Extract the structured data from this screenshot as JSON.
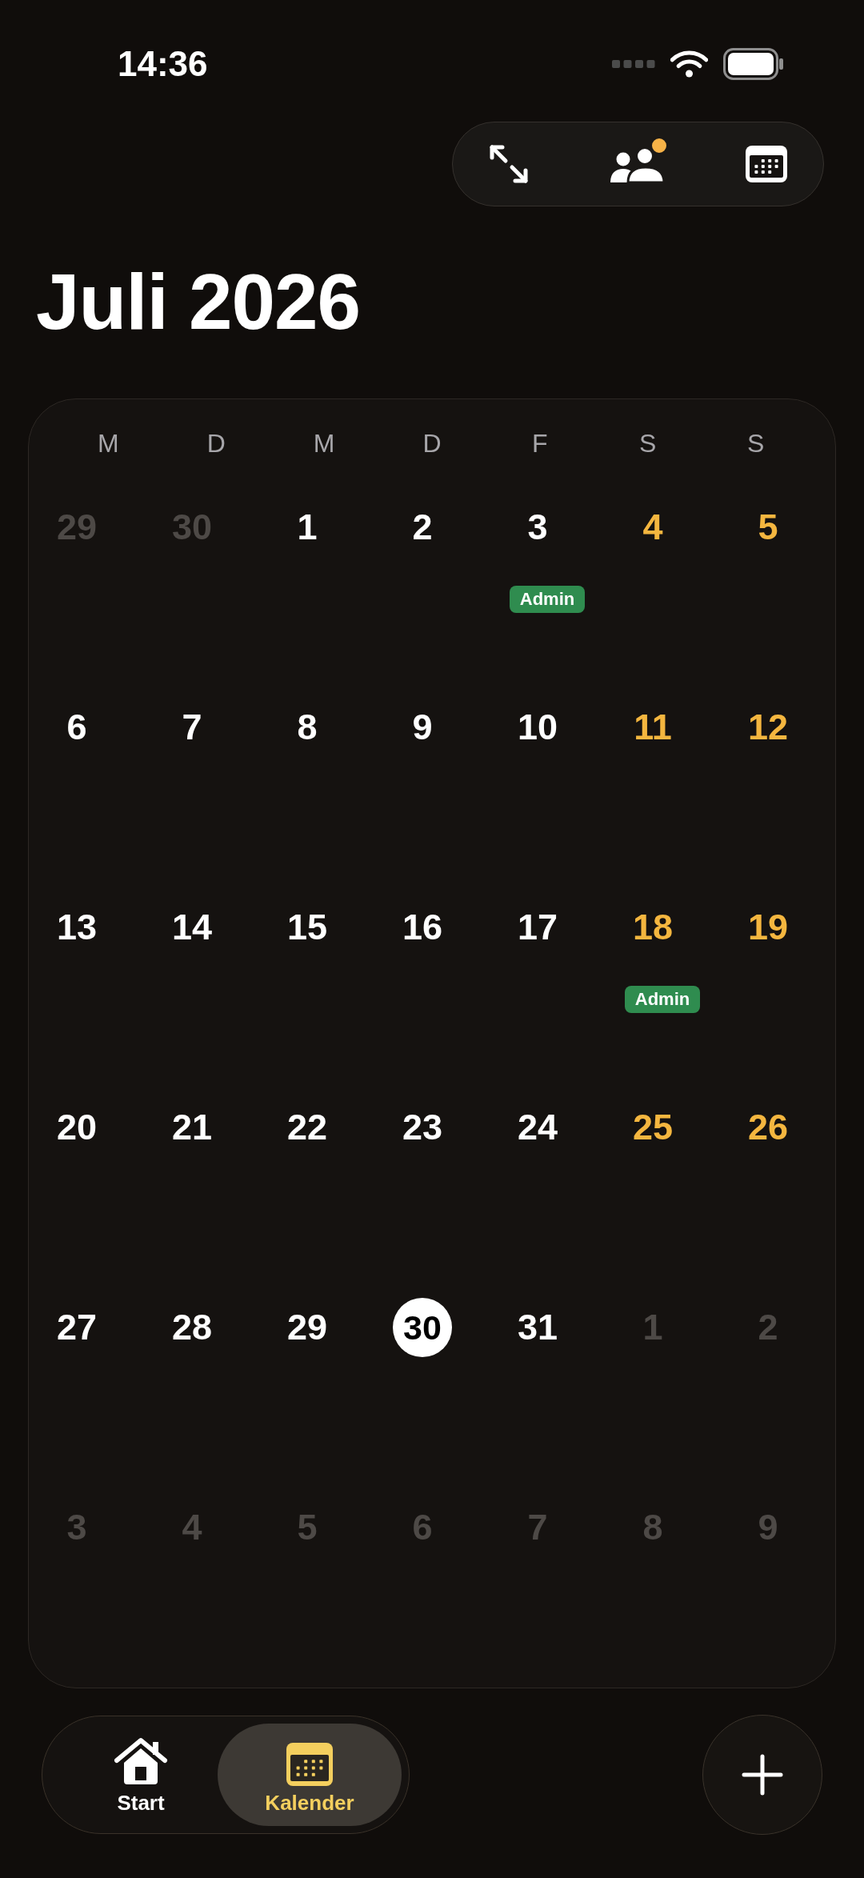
{
  "status_bar": {
    "time": "14:36"
  },
  "toolbar": {
    "buttons": [
      {
        "notify": false
      },
      {
        "notify": true
      },
      {
        "notify": false
      }
    ]
  },
  "title": "Juli 2026",
  "calendar": {
    "weekdays": [
      "M",
      "D",
      "M",
      "D",
      "F",
      "S",
      "S"
    ],
    "weeks": [
      {
        "days": [
          {
            "day": "29",
            "kind": "other_month"
          },
          {
            "day": "30",
            "kind": "other_month"
          },
          {
            "day": "1",
            "kind": "weekday"
          },
          {
            "day": "2",
            "kind": "weekday"
          },
          {
            "day": "3",
            "kind": "weekday",
            "events": [
              {
                "label": "Admin",
                "color": "#2f8c4f"
              }
            ]
          },
          {
            "day": "4",
            "kind": "weekend"
          },
          {
            "day": "5",
            "kind": "weekend"
          }
        ]
      },
      {
        "days": [
          {
            "day": "6",
            "kind": "weekday"
          },
          {
            "day": "7",
            "kind": "weekday"
          },
          {
            "day": "8",
            "kind": "weekday"
          },
          {
            "day": "9",
            "kind": "weekday"
          },
          {
            "day": "10",
            "kind": "weekday"
          },
          {
            "day": "11",
            "kind": "weekend"
          },
          {
            "day": "12",
            "kind": "weekend"
          }
        ]
      },
      {
        "days": [
          {
            "day": "13",
            "kind": "weekday"
          },
          {
            "day": "14",
            "kind": "weekday"
          },
          {
            "day": "15",
            "kind": "weekday"
          },
          {
            "day": "16",
            "kind": "weekday"
          },
          {
            "day": "17",
            "kind": "weekday"
          },
          {
            "day": "18",
            "kind": "weekend",
            "events": [
              {
                "label": "Admin",
                "color": "#2f8c4f"
              }
            ]
          },
          {
            "day": "19",
            "kind": "weekend"
          }
        ]
      },
      {
        "days": [
          {
            "day": "20",
            "kind": "weekday"
          },
          {
            "day": "21",
            "kind": "weekday"
          },
          {
            "day": "22",
            "kind": "weekday"
          },
          {
            "day": "23",
            "kind": "weekday"
          },
          {
            "day": "24",
            "kind": "weekday"
          },
          {
            "day": "25",
            "kind": "weekend"
          },
          {
            "day": "26",
            "kind": "weekend"
          }
        ]
      },
      {
        "days": [
          {
            "day": "27",
            "kind": "weekday"
          },
          {
            "day": "28",
            "kind": "weekday"
          },
          {
            "day": "29",
            "kind": "weekday"
          },
          {
            "day": "30",
            "kind": "today"
          },
          {
            "day": "31",
            "kind": "weekday"
          },
          {
            "day": "1",
            "kind": "other_month"
          },
          {
            "day": "2",
            "kind": "other_month"
          }
        ]
      },
      {
        "days": [
          {
            "day": "3",
            "kind": "other_month"
          },
          {
            "day": "4",
            "kind": "other_month"
          },
          {
            "day": "5",
            "kind": "other_month"
          },
          {
            "day": "6",
            "kind": "other_month"
          },
          {
            "day": "7",
            "kind": "other_month"
          },
          {
            "day": "8",
            "kind": "other_month"
          },
          {
            "day": "9",
            "kind": "other_month"
          }
        ]
      }
    ]
  },
  "tab_bar": {
    "tabs": [
      {
        "label": "Start",
        "selected": false
      },
      {
        "label": "Kalender",
        "selected": true
      }
    ]
  }
}
